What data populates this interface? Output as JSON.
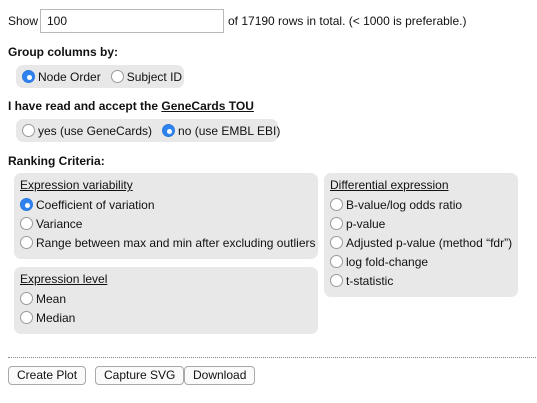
{
  "show": {
    "label": "Show",
    "value": "100",
    "rows_text": "of 17190 rows in total. (< 1000 is preferable.)"
  },
  "group": {
    "heading": "Group columns by:",
    "options": [
      {
        "label": "Node Order",
        "selected": true
      },
      {
        "label": "Subject ID",
        "selected": false
      }
    ]
  },
  "tou": {
    "heading": "I have read and accept the",
    "link": "GeneCards TOU",
    "options": [
      {
        "label": "yes (use GeneCards)",
        "selected": false
      },
      {
        "label": "no (use EMBL EBI)",
        "selected": true
      }
    ]
  },
  "ranking": {
    "heading": "Ranking Criteria:",
    "variability": {
      "title": "Expression variability",
      "options": [
        {
          "label": "Coefficient of variation",
          "selected": true
        },
        {
          "label": "Variance",
          "selected": false
        },
        {
          "label": "Range between max and min after excluding outliers",
          "selected": false
        }
      ]
    },
    "level": {
      "title": "Expression level",
      "options": [
        {
          "label": "Mean",
          "selected": false
        },
        {
          "label": "Median",
          "selected": false
        }
      ]
    },
    "differential": {
      "title": "Differential expression",
      "options": [
        {
          "label": "B-value/log odds ratio",
          "selected": false
        },
        {
          "label": "p-value",
          "selected": false
        },
        {
          "label": "Adjusted p-value (method “fdr”)",
          "selected": false
        },
        {
          "label": "log fold-change",
          "selected": false
        },
        {
          "label": "t-statistic",
          "selected": false
        }
      ]
    }
  },
  "buttons": {
    "create_plot": "Create Plot",
    "capture_svg": "Capture SVG",
    "download": "Download"
  },
  "colors": {
    "radio_selected": "#2f83f0",
    "panel_bg": "#e8e8e8"
  }
}
